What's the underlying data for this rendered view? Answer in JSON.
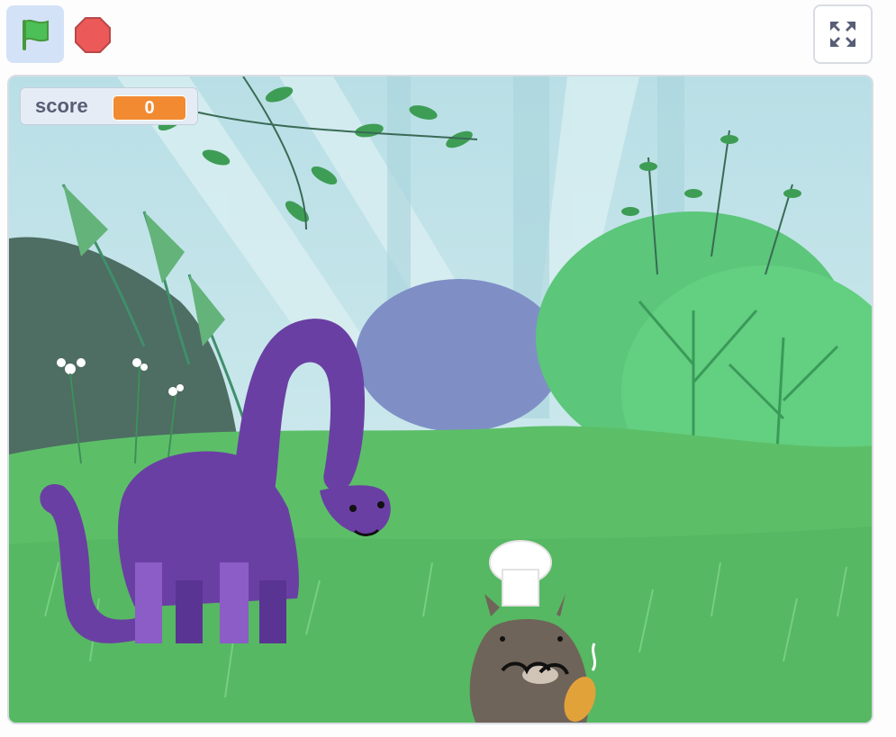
{
  "toolbar": {
    "green_flag_icon": "green-flag-icon",
    "stop_icon": "stop-sign-icon",
    "fullscreen_icon": "fullscreen-icon"
  },
  "monitor": {
    "label": "score",
    "value": "0"
  },
  "colors": {
    "flag_bg": "#d4e2f7",
    "flag_green": "#4cbf56",
    "stop_red": "#ec5959",
    "monitor_orange": "#f28a32",
    "dino_purple": "#6a3fa3",
    "grass_green": "#5cbf68"
  }
}
